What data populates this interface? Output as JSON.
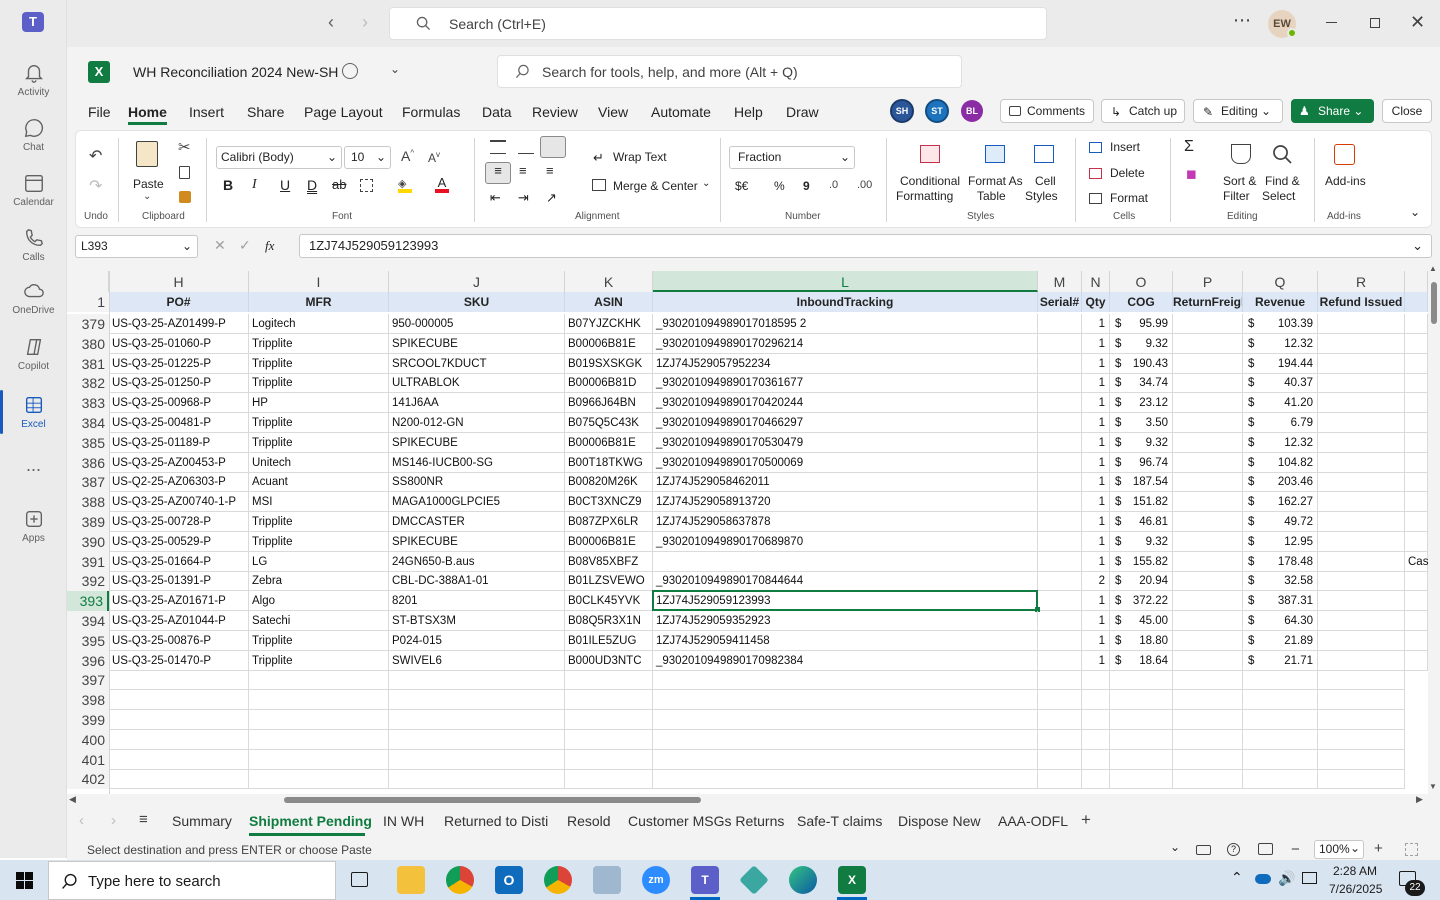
{
  "teams": {
    "search_placeholder": "Search (Ctrl+E)",
    "avatar": "EW",
    "rail": [
      {
        "label": "Activity",
        "icon": "bell-icon"
      },
      {
        "label": "Chat",
        "icon": "chat-icon"
      },
      {
        "label": "Calendar",
        "icon": "calendar-icon"
      },
      {
        "label": "Calls",
        "icon": "phone-icon"
      },
      {
        "label": "OneDrive",
        "icon": "cloud-icon"
      },
      {
        "label": "Copilot",
        "icon": "copilot-icon"
      },
      {
        "label": "Excel",
        "icon": "excel-icon"
      },
      {
        "label": "...",
        "icon": "more-icon"
      },
      {
        "label": "Apps",
        "icon": "add-app-icon"
      }
    ]
  },
  "excel": {
    "file_title": "WH Reconciliation 2024 New-SH",
    "search_placeholder": "Search for tools, help, and more (Alt + Q)",
    "tabs": [
      "File",
      "Home",
      "Insert",
      "Share",
      "Page Layout",
      "Formulas",
      "Data",
      "Review",
      "View",
      "Automate",
      "Help",
      "Draw"
    ],
    "active_tab": "Home",
    "collaborators": [
      "SH",
      "ST",
      "BL"
    ],
    "comments": "Comments",
    "catch_up": "Catch up",
    "editing": "Editing",
    "share": "Share",
    "close": "Close"
  },
  "ribbon": {
    "undo": "Undo",
    "clipboard": "Clipboard",
    "paste": "Paste",
    "font_name": "Calibri (Body)",
    "font_size": "10",
    "font": "Font",
    "wrap_text": "Wrap Text",
    "merge_center": "Merge & Center",
    "alignment": "Alignment",
    "number_format": "Fraction",
    "number": "Number",
    "currency": "$€",
    "percent": "%",
    "comma": "9",
    "cond_fmt_1": "Conditional",
    "cond_fmt_2": "Formatting",
    "fmt_table_1": "Format As",
    "fmt_table_2": "Table",
    "cell_styles_1": "Cell",
    "cell_styles_2": "Styles",
    "styles": "Styles",
    "insert": "Insert",
    "delete": "Delete",
    "format": "Format",
    "cells": "Cells",
    "sort_1": "Sort &",
    "sort_2": "Filter",
    "find_1": "Find &",
    "find_2": "Select",
    "editing_group": "Editing",
    "addins": "Add-ins",
    "addins_group": "Add-ins"
  },
  "formula_bar": {
    "name_box": "L393",
    "fx": "fx",
    "value": "1ZJ74J529059123993"
  },
  "columns": [
    "H",
    "I",
    "J",
    "K",
    "L",
    "M",
    "N",
    "O",
    "P",
    "Q",
    "R"
  ],
  "header_row": {
    "num": "1",
    "cells": [
      "PO#",
      "MFR",
      "SKU",
      "ASIN",
      "InboundTracking",
      "Serial#",
      "Qty",
      "COG",
      "ReturnFreight",
      "Revenue",
      "Refund Issued"
    ]
  },
  "rows": [
    {
      "n": "379",
      "po": "US-Q3-25-AZ01499-P",
      "mfr": "Logitech",
      "sku": "950-000005",
      "asin": "B07YJZCKHK",
      "trk": "_930201094989017018595 2",
      "qty": "1",
      "cog": "95.99",
      "rev": "103.39",
      "r": ""
    },
    {
      "n": "380",
      "po": "US-Q3-25-01060-P",
      "mfr": "Tripplite",
      "sku": "SPIKECUBE",
      "asin": "B00006B81E",
      "trk": "_9302010949890170296214",
      "qty": "1",
      "cog": "9.32",
      "rev": "12.32",
      "r": ""
    },
    {
      "n": "381",
      "po": "US-Q3-25-01225-P",
      "mfr": "Tripplite",
      "sku": "SRCOOL7KDUCT",
      "asin": "B019SXSKGK",
      "trk": "1ZJ74J529057952234",
      "qty": "1",
      "cog": "190.43",
      "rev": "194.44",
      "r": ""
    },
    {
      "n": "382",
      "po": "US-Q3-25-01250-P",
      "mfr": "Tripplite",
      "sku": "ULTRABLOK",
      "asin": "B00006B81D",
      "trk": "_9302010949890170361677",
      "qty": "1",
      "cog": "34.74",
      "rev": "40.37",
      "r": ""
    },
    {
      "n": "383",
      "po": "US-Q3-25-00968-P",
      "mfr": "HP",
      "sku": "141J6AA",
      "asin": "B0966J64BN",
      "trk": "_9302010949890170420244",
      "qty": "1",
      "cog": "23.12",
      "rev": "41.20",
      "r": ""
    },
    {
      "n": "384",
      "po": "US-Q3-25-00481-P",
      "mfr": "Tripplite",
      "sku": "N200-012-GN",
      "asin": "B075Q5C43K",
      "trk": "_9302010949890170466297",
      "qty": "1",
      "cog": "3.50",
      "rev": "6.79",
      "r": ""
    },
    {
      "n": "385",
      "po": "US-Q3-25-01189-P",
      "mfr": "Tripplite",
      "sku": "SPIKECUBE",
      "asin": "B00006B81E",
      "trk": "_9302010949890170530479",
      "qty": "1",
      "cog": "9.32",
      "rev": "12.32",
      "r": ""
    },
    {
      "n": "386",
      "po": "US-Q3-25-AZ00453-P",
      "mfr": "Unitech",
      "sku": "MS146-IUCB00-SG",
      "asin": "B00T18TKWG",
      "trk": "_9302010949890170500069",
      "qty": "1",
      "cog": "96.74",
      "rev": "104.82",
      "r": ""
    },
    {
      "n": "387",
      "po": "US-Q2-25-AZ06303-P",
      "mfr": "Acuant",
      "sku": "SS800NR",
      "asin": "B00820M26K",
      "trk": "1ZJ74J529058462011",
      "qty": "1",
      "cog": "187.54",
      "rev": "203.46",
      "r": ""
    },
    {
      "n": "388",
      "po": "US-Q3-25-AZ00740-1-P",
      "mfr": "MSI",
      "sku": "MAGA1000GLPCIE5",
      "asin": "B0CT3XNCZ9",
      "trk": "1ZJ74J529058913720",
      "qty": "1",
      "cog": "151.82",
      "rev": "162.27",
      "r": ""
    },
    {
      "n": "389",
      "po": "US-Q3-25-00728-P",
      "mfr": "Tripplite",
      "sku": "DMCCASTER",
      "asin": "B087ZPX6LR",
      "trk": "1ZJ74J529058637878",
      "qty": "1",
      "cog": "46.81",
      "rev": "49.72",
      "r": ""
    },
    {
      "n": "390",
      "po": "US-Q3-25-00529-P",
      "mfr": "Tripplite",
      "sku": "SPIKECUBE",
      "asin": "B00006B81E",
      "trk": "_9302010949890170689870",
      "qty": "1",
      "cog": "9.32",
      "rev": "12.95",
      "r": ""
    },
    {
      "n": "391",
      "po": "US-Q3-25-01664-P",
      "mfr": "LG",
      "sku": "24GN650-B.aus",
      "asin": "B08V85XBFZ",
      "trk": "",
      "qty": "1",
      "cog": "155.82",
      "rev": "178.48",
      "r": "Case"
    },
    {
      "n": "392",
      "po": "US-Q3-25-01391-P",
      "mfr": "Zebra",
      "sku": "CBL-DC-388A1-01",
      "asin": "B01LZSVEWO",
      "trk": "_9302010949890170844644",
      "qty": "2",
      "cog": "20.94",
      "rev": "32.58",
      "r": ""
    },
    {
      "n": "393",
      "po": "US-Q3-25-AZ01671-P",
      "mfr": "Algo",
      "sku": "8201",
      "asin": "B0CLK45YVK",
      "trk": "1ZJ74J529059123993",
      "qty": "1",
      "cog": "372.22",
      "rev": "387.31",
      "r": ""
    },
    {
      "n": "394",
      "po": "US-Q3-25-AZ01044-P",
      "mfr": "Satechi",
      "sku": "ST-BTSX3M",
      "asin": "B08Q5R3X1N",
      "trk": "1ZJ74J529059352923",
      "qty": "1",
      "cog": "45.00",
      "rev": "64.30",
      "r": ""
    },
    {
      "n": "395",
      "po": "US-Q3-25-00876-P",
      "mfr": "Tripplite",
      "sku": "P024-015",
      "asin": "B01ILE5ZUG",
      "trk": "1ZJ74J529059411458",
      "qty": "1",
      "cog": "18.80",
      "rev": "21.89",
      "r": ""
    },
    {
      "n": "396",
      "po": "US-Q3-25-01470-P",
      "mfr": "Tripplite",
      "sku": "SWIVEL6",
      "asin": "B000UD3NTC",
      "trk": "_9302010949890170982384",
      "qty": "1",
      "cog": "18.64",
      "rev": "21.71",
      "r": ""
    }
  ],
  "empty_rows": [
    "397",
    "398",
    "399",
    "400",
    "401",
    "402"
  ],
  "currency_symbol": "$",
  "sheet_tabs": [
    "Summary",
    "Shipment Pending",
    "IN WH",
    "Returned to Disti",
    "Resold",
    "Customer MSGs Returns",
    "Safe-T claims",
    "Dispose New",
    "AAA-ODFL"
  ],
  "active_sheet": "Shipment Pending",
  "status": {
    "message": "Select destination and press ENTER or choose Paste",
    "zoom": "100%"
  },
  "taskbar": {
    "search_placeholder": "Type here to search",
    "time": "2:28 AM",
    "date": "7/26/2025",
    "notifications": "22"
  },
  "colors": {
    "excel_green": "#107c41",
    "selection": "#217346",
    "header_fill": "#dde7f5",
    "teams_purple": "#5b5fc7"
  }
}
